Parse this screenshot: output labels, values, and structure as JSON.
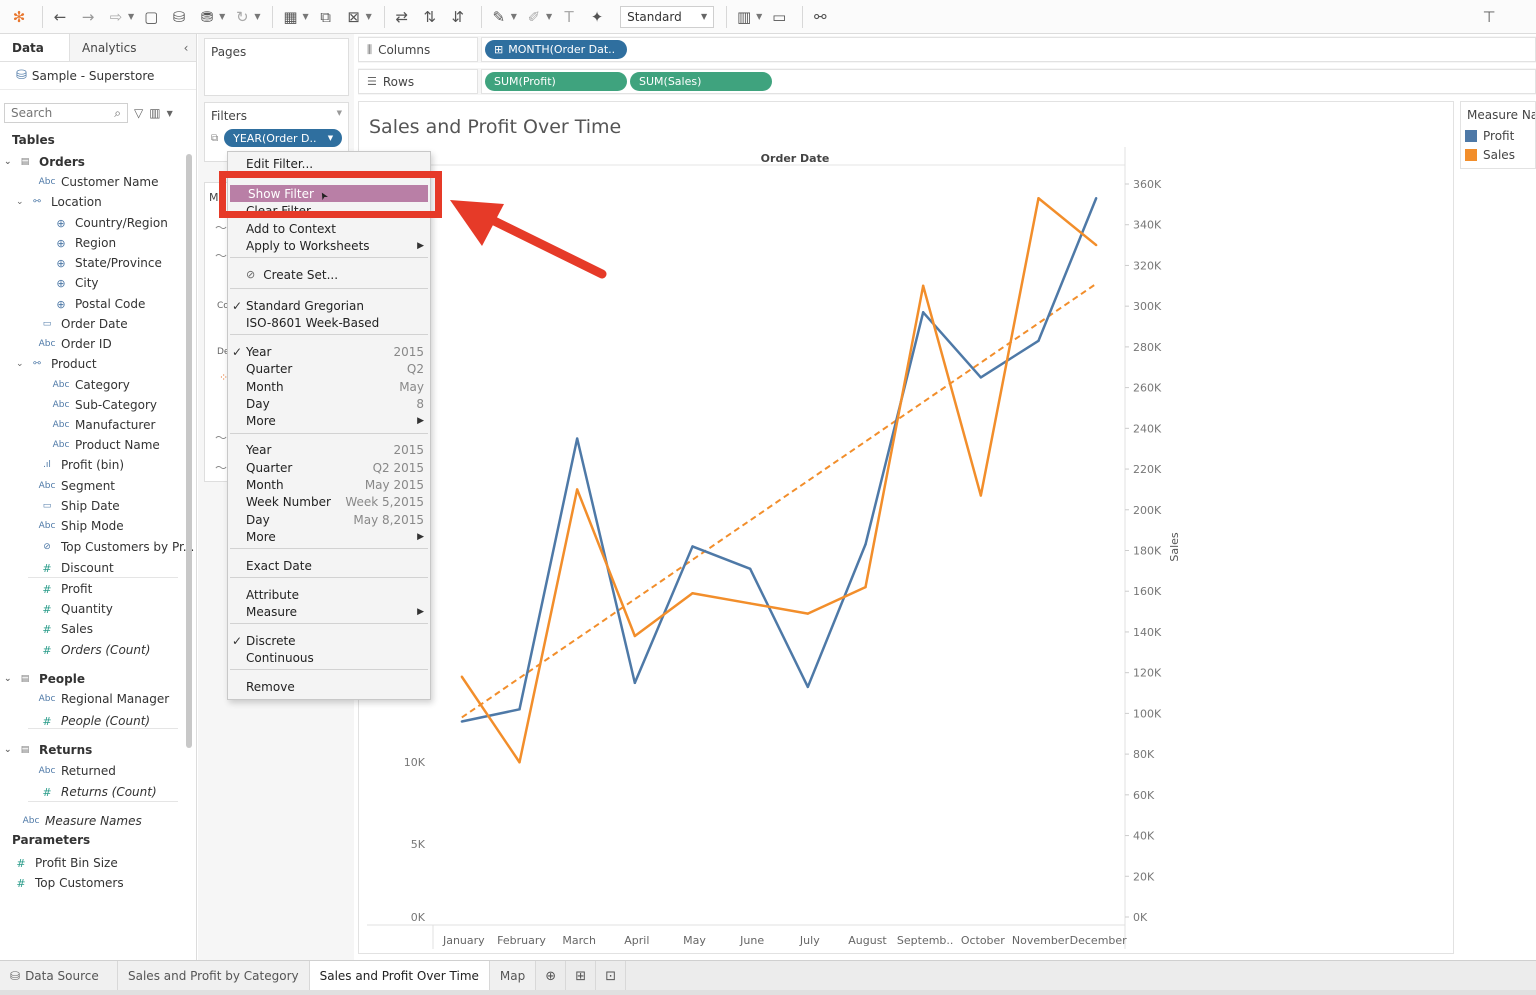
{
  "toolbar": {
    "view_mode": "Standard",
    "icons": [
      "tableau-logo-icon",
      "undo-icon",
      "redo-icon",
      "forward-icon",
      "save-icon",
      "new-datasource-icon",
      "pause-icon",
      "refresh-icon",
      "new-worksheet-icon",
      "duplicate-icon",
      "clear-icon",
      "swap-icon",
      "sort-asc-icon",
      "sort-desc-icon",
      "highlight-icon",
      "group-icon",
      "label-icon",
      "pin-icon",
      "show-me-icon",
      "presentation-icon",
      "share-icon",
      "pin-tb-icon"
    ]
  },
  "data_pane": {
    "tab_data": "Data",
    "tab_analytics": "Analytics",
    "data_source": "Sample - Superstore",
    "search_placeholder": "Search",
    "tables_header": "Tables",
    "parameters_header": "Parameters",
    "fields": [
      {
        "label": "Orders",
        "type": "group"
      },
      {
        "label": "Customer Name",
        "type": "dim"
      },
      {
        "label": "Location",
        "type": "hier"
      },
      {
        "label": "Country/Region",
        "type": "geo"
      },
      {
        "label": "Region",
        "type": "geo"
      },
      {
        "label": "State/Province",
        "type": "geo"
      },
      {
        "label": "City",
        "type": "geo"
      },
      {
        "label": "Postal Code",
        "type": "geo"
      },
      {
        "label": "Order Date",
        "type": "date"
      },
      {
        "label": "Order ID",
        "type": "dim"
      },
      {
        "label": "Product",
        "type": "hier"
      },
      {
        "label": "Category",
        "type": "dim"
      },
      {
        "label": "Sub-Category",
        "type": "dim"
      },
      {
        "label": "Manufacturer",
        "type": "dim"
      },
      {
        "label": "Product Name",
        "type": "dim"
      },
      {
        "label": "Profit (bin)",
        "type": "bin"
      },
      {
        "label": "Segment",
        "type": "dim"
      },
      {
        "label": "Ship Date",
        "type": "date"
      },
      {
        "label": "Ship Mode",
        "type": "dim"
      },
      {
        "label": "Top Customers by Pr...",
        "type": "set"
      },
      {
        "label": "Discount",
        "type": "meas"
      },
      {
        "label": "Profit",
        "type": "meas"
      },
      {
        "label": "Quantity",
        "type": "meas"
      },
      {
        "label": "Sales",
        "type": "meas"
      },
      {
        "label": "Orders (Count)",
        "type": "meas"
      },
      {
        "label": "People",
        "type": "group"
      },
      {
        "label": "Regional Manager",
        "type": "dim"
      },
      {
        "label": "People (Count)",
        "type": "meas"
      },
      {
        "label": "Returns",
        "type": "group"
      },
      {
        "label": "Returned",
        "type": "dim"
      },
      {
        "label": "Returns (Count)",
        "type": "meas"
      },
      {
        "label": "Measure Names",
        "type": "dim"
      }
    ],
    "parameters": [
      "Profit Bin Size",
      "Top Customers"
    ]
  },
  "shelves": {
    "pages_label": "Pages",
    "filters_label": "Filters",
    "filter_pill": "YEAR(Order D..",
    "columns_label": "Columns",
    "rows_label": "Rows",
    "columns_pill": "MONTH(Order Dat..",
    "rows_pill_1": "SUM(Profit)",
    "rows_pill_2": "SUM(Sales)"
  },
  "context_menu": {
    "items": [
      {
        "label": "Edit Filter..."
      },
      {
        "label": "Show Filter",
        "highlighted": true
      },
      {
        "label": "Clear Filter"
      },
      {
        "label": "Add to Context"
      },
      {
        "label": "Apply to Worksheets",
        "submenu": true
      },
      {
        "label": "Create Set...",
        "icon": "set-icon"
      },
      {
        "label": "Standard Gregorian",
        "checked": true
      },
      {
        "label": "ISO-8601 Week-Based"
      },
      {
        "label": "Year",
        "checked": true,
        "value": "2015"
      },
      {
        "label": "Quarter",
        "value": "Q2"
      },
      {
        "label": "Month",
        "value": "May"
      },
      {
        "label": "Day",
        "value": "8"
      },
      {
        "label": "More",
        "submenu": true
      },
      {
        "label": "Year",
        "value": "2015"
      },
      {
        "label": "Quarter",
        "value": "Q2 2015"
      },
      {
        "label": "Month",
        "value": "May 2015"
      },
      {
        "label": "Week Number",
        "value": "Week 5,2015"
      },
      {
        "label": "Day",
        "value": "May 8,2015"
      },
      {
        "label": "More",
        "submenu": true
      },
      {
        "label": "Exact Date"
      },
      {
        "label": "Attribute"
      },
      {
        "label": "Measure",
        "submenu": true
      },
      {
        "label": "Discrete",
        "checked": true
      },
      {
        "label": "Continuous"
      },
      {
        "label": "Remove"
      }
    ]
  },
  "worksheet": {
    "title": "Sales and Profit Over Time"
  },
  "legend": {
    "title": "Measure Names",
    "items": [
      {
        "label": "Profit",
        "color": "#4e79a7"
      },
      {
        "label": "Sales",
        "color": "#f28e2b"
      }
    ]
  },
  "chart_data": {
    "type": "line",
    "title": "Sales and Profit Over Time",
    "xlabel": "Order Date",
    "ylabel_right": "Sales",
    "categories": [
      "January",
      "February",
      "March",
      "April",
      "May",
      "June",
      "July",
      "August",
      "Septemb..",
      "October",
      "November",
      "December"
    ],
    "left_axis_ticks": [
      "0K",
      "5K",
      "10K"
    ],
    "right_axis_ticks": [
      "0K",
      "20K",
      "40K",
      "60K",
      "80K",
      "100K",
      "120K",
      "140K",
      "160K",
      "180K",
      "200K",
      "220K",
      "240K",
      "260K",
      "280K",
      "300K",
      "320K",
      "340K",
      "360K"
    ],
    "right_axis_range": [
      0,
      360000
    ],
    "series": [
      {
        "name": "Profit",
        "color": "#4e79a7",
        "values": [
          96000,
          102000,
          235000,
          115000,
          182000,
          171000,
          113000,
          183000,
          297000,
          265000,
          283000,
          353000
        ]
      },
      {
        "name": "Sales",
        "color": "#f28e2b",
        "values": [
          118000,
          76000,
          210000,
          138000,
          159000,
          154000,
          149000,
          162000,
          310000,
          207000,
          353000,
          330000
        ]
      }
    ],
    "trend_line": {
      "color": "#f28e2b",
      "start": 98000,
      "end": 311000
    }
  },
  "bottom_tabs": {
    "data_source": "Data Source",
    "sheets": [
      "Sales and Profit by Category",
      "Sales and Profit Over Time",
      "Map"
    ],
    "active": "Sales and Profit Over Time"
  }
}
